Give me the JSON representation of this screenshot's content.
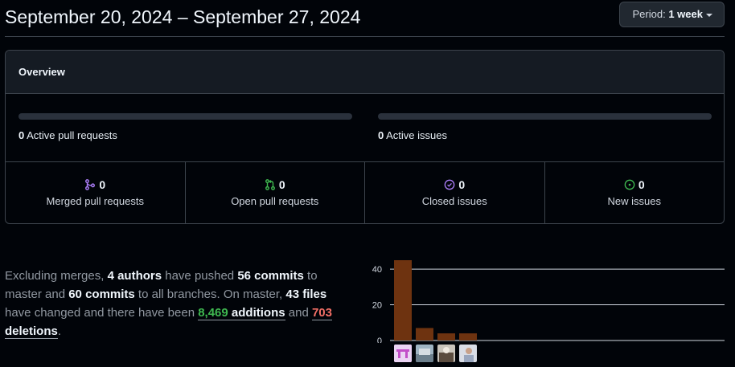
{
  "header": {
    "title": "September 20, 2024 – September 27, 2024",
    "period_prefix": "Period:",
    "period_value": "1 week"
  },
  "overview": {
    "title": "Overview",
    "active_pull_requests": {
      "count": "0",
      "label": "Active pull requests",
      "fill_fraction": 0
    },
    "active_issues": {
      "count": "0",
      "label": "Active issues",
      "fill_fraction": 0
    },
    "stats": [
      {
        "icon": "merge-icon",
        "count": "0",
        "label": "Merged pull requests",
        "color": "#ab7df8"
      },
      {
        "icon": "pull-request-icon",
        "count": "0",
        "label": "Open pull requests",
        "color": "#3fb950"
      },
      {
        "icon": "check-circle-icon",
        "count": "0",
        "label": "Closed issues",
        "color": "#ab7df8"
      },
      {
        "icon": "issue-opened-icon",
        "count": "0",
        "label": "New issues",
        "color": "#3fb950"
      }
    ]
  },
  "summary": {
    "t1": "Excluding merges, ",
    "authors": "4 authors",
    "t2": " have pushed ",
    "commits_master": "56 commits",
    "t3": " to master and ",
    "commits_all": "60 commits",
    "t4": " to all branches. On master, ",
    "files": "43 files",
    "t5": " have changed and there have been ",
    "additions_num": "8,469",
    "additions_word": " additions",
    "t6": " and ",
    "deletions_num": "703",
    "deletions_word": " deletions",
    "t7": "."
  },
  "chart_data": {
    "type": "bar",
    "y_ticks": [
      "40",
      "20",
      "0"
    ],
    "ylim": [
      0,
      45
    ],
    "values": [
      45,
      7,
      4,
      4
    ],
    "bar_color": "#6e3310",
    "grid": true
  }
}
